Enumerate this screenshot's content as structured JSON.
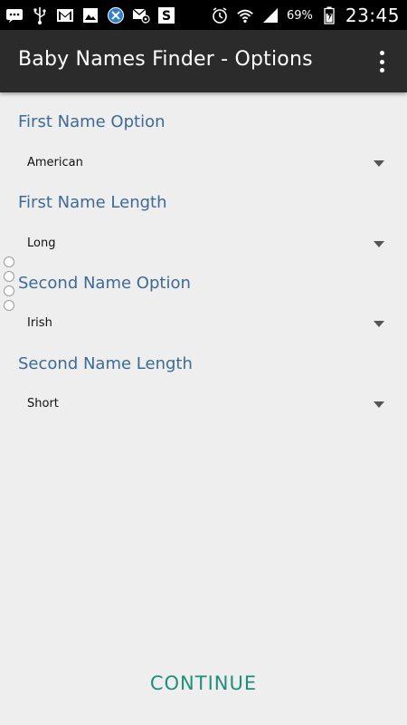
{
  "status_bar": {
    "battery_percent": "69%",
    "time": "23:45",
    "icons_left": [
      "chat-icon",
      "usb-icon",
      "gmail-icon",
      "image-icon",
      "app-icon",
      "email-icon",
      "s-icon"
    ],
    "icons_right": [
      "alarm-icon",
      "wifi-icon",
      "signal-icon",
      "battery-charging-icon"
    ]
  },
  "app_bar": {
    "title": "Baby Names Finder - Options",
    "menu_icon": "overflow-menu-icon"
  },
  "options": [
    {
      "label": "First Name Option",
      "value": "American"
    },
    {
      "label": "First Name Length",
      "value": "Long"
    },
    {
      "label": "Second Name Option",
      "value": "Irish"
    },
    {
      "label": "Second Name Length",
      "value": "Short"
    }
  ],
  "footer": {
    "continue_label": "CONTINUE"
  },
  "colors": {
    "status_bar": "#000000",
    "app_bar": "#2b2b2b",
    "background": "#eeeeee",
    "label": "#3d6a96",
    "continue": "#1f8f7c"
  }
}
